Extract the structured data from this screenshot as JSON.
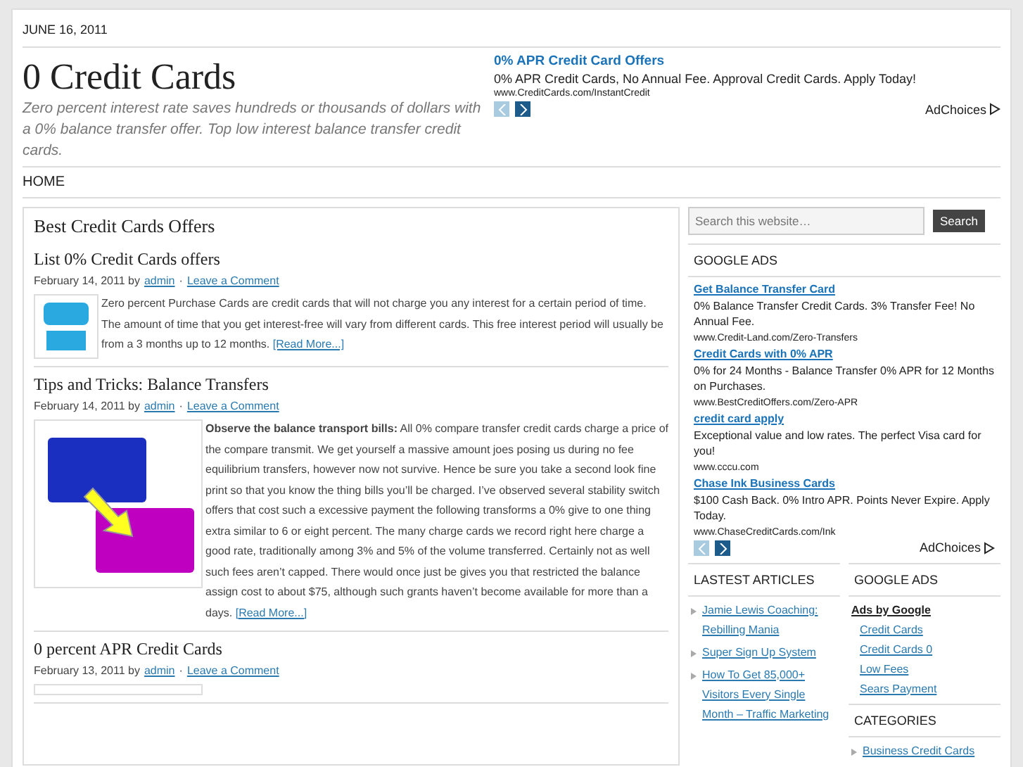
{
  "date": "JUNE 16, 2011",
  "site": {
    "title": "0 Credit Cards",
    "tagline": "Zero percent interest rate saves hundreds or thousands of dollars with a 0% balance transfer offer. Top low interest balance transfer credit cards."
  },
  "header_ad": {
    "title": "0% APR Credit Card Offers",
    "text": "0% APR Credit Cards, No Annual Fee. Approval Credit Cards. Apply Today!",
    "url": "www.CreditCards.com/InstantCredit",
    "adchoices": "AdChoices"
  },
  "nav": [
    {
      "label": "HOME"
    }
  ],
  "main": {
    "heading": "Best Credit Cards Offers",
    "posts": [
      {
        "title": "List 0% Credit Cards offers",
        "date": "February 14, 2011",
        "by": "by",
        "author": "admin",
        "sep": "·",
        "comment": "Leave a Comment",
        "kind": "badge",
        "body": "Zero percent Purchase Cards are credit cards that will not charge you any interest for a certain period of time. The amount of time that you get interest-free will vary from different cards. This free interest period will usually be from a 3 months up to 12 months.",
        "more": "[Read More...]"
      },
      {
        "title": "Tips and Tricks: Balance Transfers",
        "date": "February 14, 2011",
        "by": "by",
        "author": "admin",
        "sep": "·",
        "comment": "Leave a Comment",
        "kind": "cards",
        "body": "**Observe the balance transport bills:** All 0% compare transfer credit cards charge a price of the compare transmit. We get yourself a massive amount joes posing us during no fee equilibrium transfers, however now not survive. Hence be sure you take a second look fine print so that you know the thing bills you’ll be charged. I’ve observed several stability switch offers that cost such a excessive payment the following transforms a 0% give to one thing extra similar to 6 or eight percent. The many charge cards we record right here charge a good rate, traditionally among 3% and 5% of the volume transferred. Certainly not as well such fees aren’t capped. There would once just be gives you that restricted the balance assign cost to about $75, although such grants haven’t become available for more than a days.",
        "more": "[Read More...]"
      },
      {
        "title": "0 percent APR Credit Cards",
        "date": "February 13, 2011",
        "by": "by",
        "author": "admin",
        "sep": "·",
        "comment": "Leave a Comment",
        "kind": "blank"
      }
    ]
  },
  "sidebar": {
    "search": {
      "placeholder": "Search this website…",
      "button": "Search"
    },
    "google_ads": {
      "heading": "GOOGLE ADS",
      "ads": [
        {
          "title": "Get Balance Transfer Card",
          "text": "0% Balance Transfer Credit Cards. 3% Transfer Fee! No Annual Fee.",
          "url": "www.Credit-Land.com/Zero-Transfers"
        },
        {
          "title": "Credit Cards with 0% APR",
          "text": "0% for 24 Months - Balance Transfer 0% APR for 12 Months on Purchases.",
          "url": "www.BestCreditOffers.com/Zero-APR"
        },
        {
          "title": "credit card apply",
          "text": "Exceptional value and low rates. The perfect Visa card for you!",
          "url": "www.cccu.com"
        },
        {
          "title": "Chase Ink Business Cards",
          "text": "$100 Cash Back. 0% Intro APR. Points Never Expire. Apply Today.",
          "url": "www.ChaseCreditCards.com/Ink"
        }
      ],
      "adchoices": "AdChoices"
    },
    "latest": {
      "heading": "LASTEST ARTICLES",
      "items": [
        "Jamie Lewis Coaching: Rebilling Mania",
        "Super Sign Up System",
        "How To Get 85,000+ Visitors Every Single Month – Traffic Marketing"
      ]
    },
    "ads_by_google": {
      "heading": "GOOGLE ADS",
      "label": "Ads by Google",
      "links": [
        "Credit Cards",
        "Credit Cards 0",
        "Low Fees",
        "Sears Payment"
      ]
    },
    "categories": {
      "heading": "CATEGORIES",
      "items": [
        "Business Credit Cards"
      ]
    }
  }
}
